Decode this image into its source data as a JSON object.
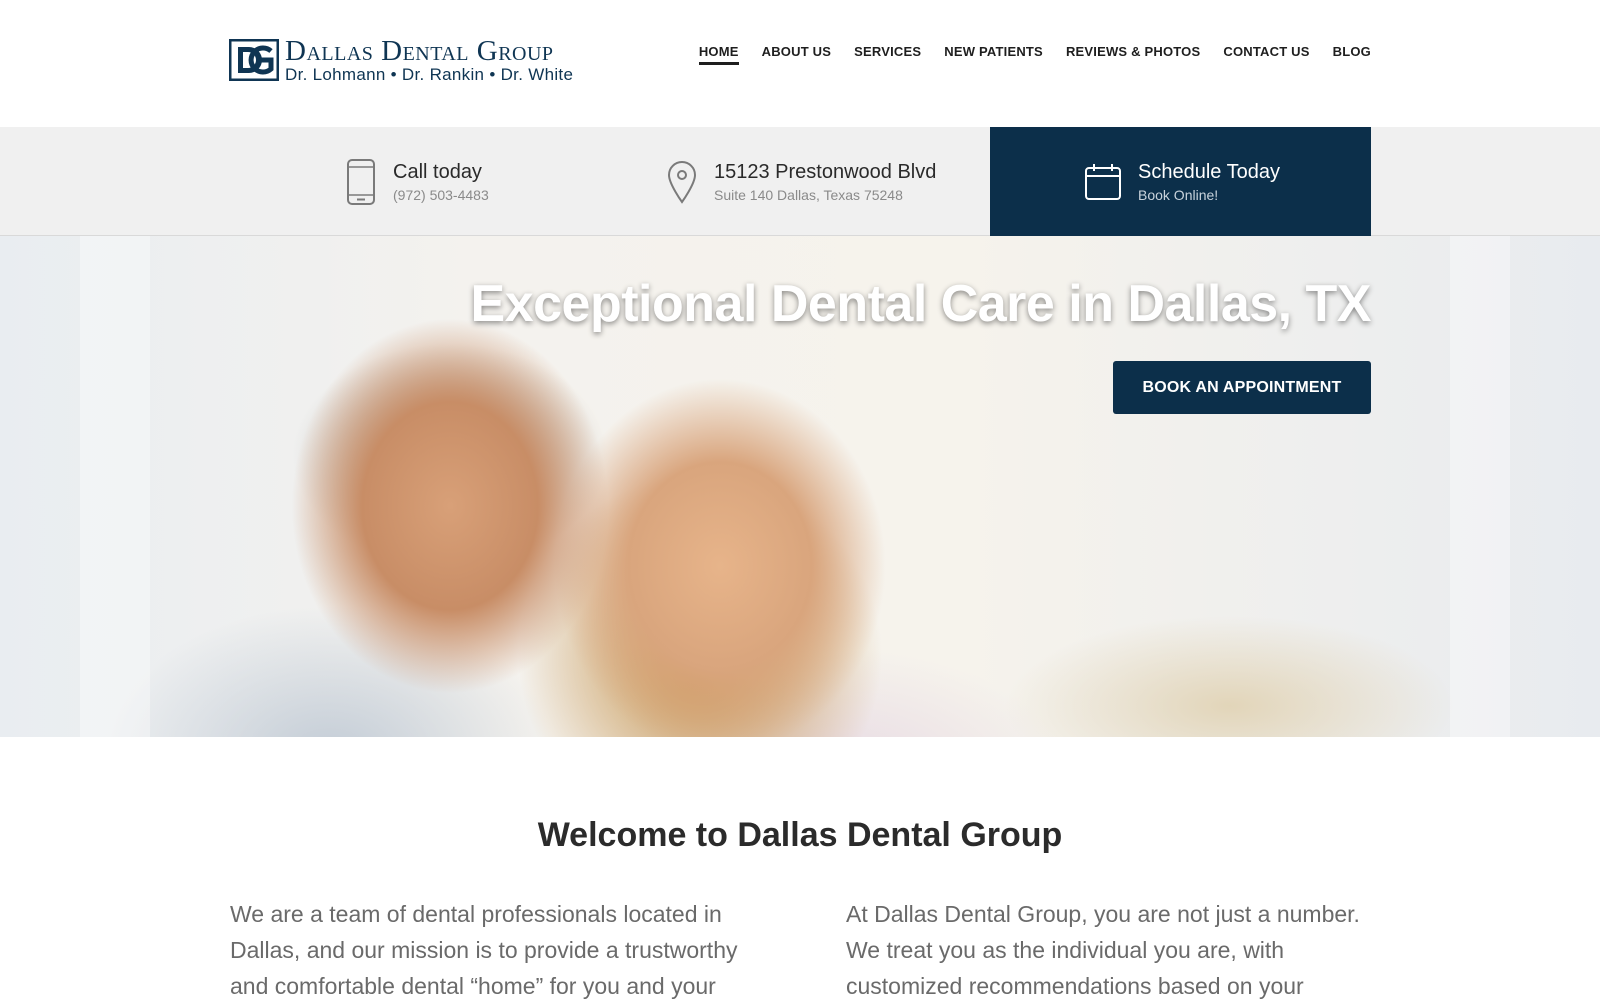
{
  "brand": {
    "name": "Dallas Dental Group",
    "doctors": "Dr. Lohmann •  Dr. Rankin • Dr. White",
    "monogram": "DG",
    "primary_color": "#0c2f4a"
  },
  "nav": {
    "items": [
      {
        "label": "HOME",
        "active": true
      },
      {
        "label": "ABOUT US"
      },
      {
        "label": "SERVICES"
      },
      {
        "label": "NEW PATIENTS"
      },
      {
        "label": "REVIEWS & PHOTOS"
      },
      {
        "label": "CONTACT US"
      },
      {
        "label": "BLOG"
      }
    ]
  },
  "infobar": {
    "call": {
      "title": "Call today",
      "sub": "(972) 503-4483",
      "icon": "phone-icon"
    },
    "address": {
      "title": "15123 Prestonwood Blvd",
      "sub": "Suite 140 Dallas, Texas 75248",
      "icon": "map-pin-icon"
    },
    "schedule": {
      "title": "Schedule Today",
      "sub": "Book Online!",
      "icon": "calendar-icon"
    }
  },
  "hero": {
    "title": "Exceptional Dental Care in Dallas, TX",
    "button": "BOOK AN APPOINTMENT"
  },
  "welcome": {
    "title": "Welcome to Dallas Dental Group",
    "left": "We are a team of dental professionals located in Dallas, and our mission is to provide a trustworthy and comfortable dental “home” for you and your",
    "right": "At Dallas Dental Group, you are not just a number. We treat you as the individual you are, with customized recommendations based on your unique needs as"
  }
}
